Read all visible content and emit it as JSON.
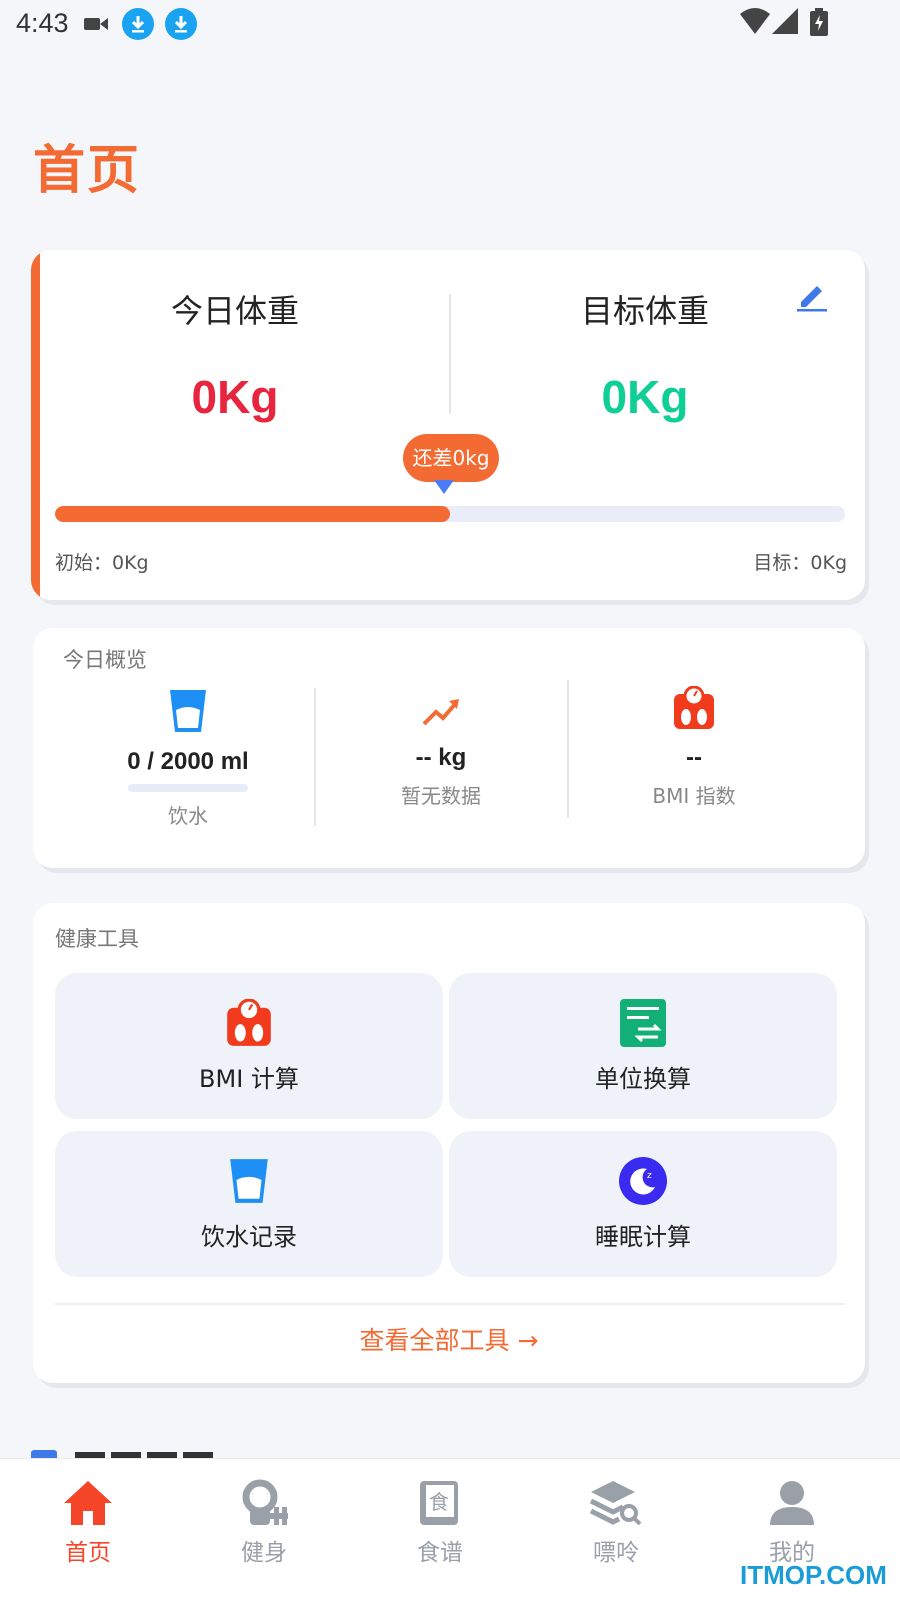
{
  "status_bar": {
    "time": "4:43"
  },
  "page": {
    "title": "首页"
  },
  "weight": {
    "today_label": "今日体重",
    "today_value": "0Kg",
    "target_label": "目标体重",
    "target_value": "0Kg",
    "difference": "还差0kg",
    "progress": 0.5,
    "start": "初始：0Kg",
    "goal": "目标：0Kg"
  },
  "overview": {
    "title": "今日概览",
    "water_value": "0 / 2000 ml",
    "water_label": "饮水",
    "trend_value": "-- kg",
    "trend_label": "暂无数据",
    "bmi_value": "--",
    "bmi_label": "BMI 指数"
  },
  "tools": {
    "title": "健康工具",
    "items": [
      {
        "label": "BMI 计算",
        "icon": "scale-icon"
      },
      {
        "label": "单位换算",
        "icon": "convert-icon"
      },
      {
        "label": "饮水记录",
        "icon": "water-cup-icon"
      },
      {
        "label": "睡眠计算",
        "icon": "moon-icon"
      }
    ],
    "view_all": "查看全部工具 →"
  },
  "tabbar": {
    "items": [
      {
        "label": "首页",
        "icon": "home-icon",
        "active": true
      },
      {
        "label": "健身",
        "icon": "fitness-icon",
        "active": false
      },
      {
        "label": "食谱",
        "icon": "recipe-book-icon",
        "active": false
      },
      {
        "label": "嘌呤",
        "icon": "layers-search-icon",
        "active": false
      },
      {
        "label": "我的",
        "icon": "profile-icon",
        "active": false
      }
    ]
  },
  "watermark": "ITMOP.COM",
  "colors": {
    "accent": "#f36a32",
    "today_weight": "#e8253f",
    "target_weight": "#10cf96",
    "inactive_tab": "#9aa0a8"
  }
}
